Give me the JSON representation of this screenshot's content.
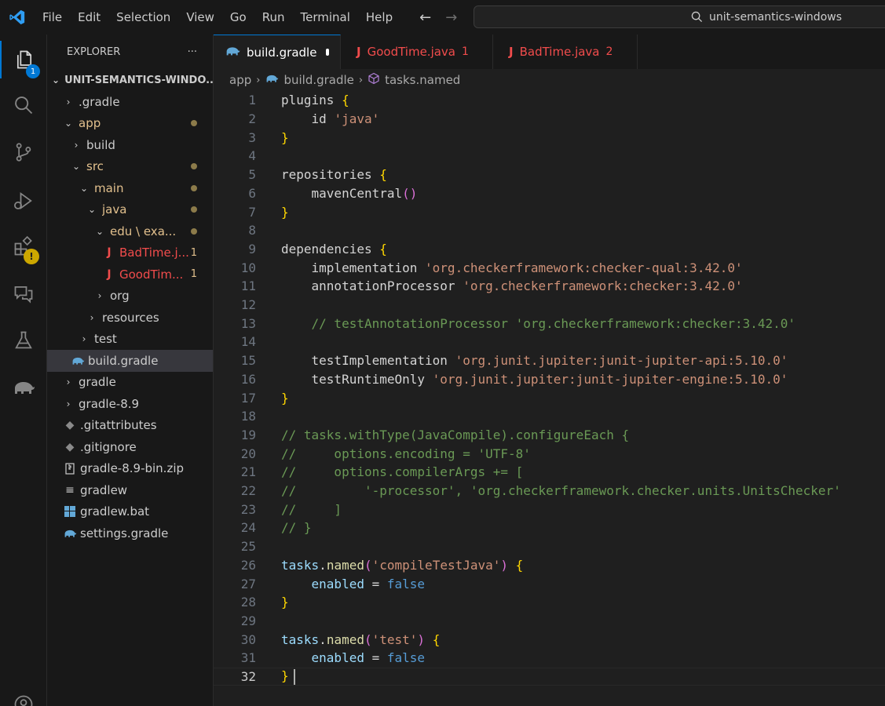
{
  "menu": [
    "File",
    "Edit",
    "Selection",
    "View",
    "Go",
    "Run",
    "Terminal",
    "Help"
  ],
  "search": {
    "text": "unit-semantics-windows"
  },
  "activity": {
    "explorer_badge": "1",
    "extensions_warning": "!"
  },
  "explorer": {
    "title": "EXPLORER",
    "more": "···",
    "root": "UNIT-SEMANTICS-WINDO...",
    "items": [
      {
        "label": ".gradle",
        "depth": 0,
        "kind": "folder",
        "open": false,
        "status": ""
      },
      {
        "label": "app",
        "depth": 0,
        "kind": "folder",
        "open": true,
        "status": "modified",
        "marker": "dot"
      },
      {
        "label": "build",
        "depth": 1,
        "kind": "folder",
        "open": false,
        "status": ""
      },
      {
        "label": "src",
        "depth": 1,
        "kind": "folder",
        "open": true,
        "status": "modified",
        "marker": "dot"
      },
      {
        "label": "main",
        "depth": 2,
        "kind": "folder",
        "open": true,
        "status": "modified",
        "marker": "dot"
      },
      {
        "label": "java",
        "depth": 3,
        "kind": "folder",
        "open": true,
        "status": "modified",
        "marker": "dot"
      },
      {
        "label": "edu \\ exa...",
        "depth": 4,
        "kind": "folder",
        "open": true,
        "status": "modified",
        "marker": "dot"
      },
      {
        "label": "BadTime.j...",
        "depth": 5,
        "kind": "java",
        "status": "modified",
        "marker": "count",
        "count": "1"
      },
      {
        "label": "GoodTim...",
        "depth": 5,
        "kind": "java",
        "status": "modified",
        "marker": "count",
        "count": "1"
      },
      {
        "label": "org",
        "depth": 4,
        "kind": "folder",
        "open": false,
        "status": ""
      },
      {
        "label": "resources",
        "depth": 3,
        "kind": "folder",
        "open": false,
        "status": ""
      },
      {
        "label": "test",
        "depth": 2,
        "kind": "folder",
        "open": false,
        "status": ""
      },
      {
        "label": "build.gradle",
        "depth": 1,
        "kind": "gradle",
        "status": "",
        "selected": true
      },
      {
        "label": "gradle",
        "depth": 0,
        "kind": "folder",
        "open": false,
        "status": ""
      },
      {
        "label": "gradle-8.9",
        "depth": 0,
        "kind": "folder",
        "open": false,
        "status": ""
      },
      {
        "label": ".gitattributes",
        "depth": 0,
        "kind": "git",
        "status": ""
      },
      {
        "label": ".gitignore",
        "depth": 0,
        "kind": "git",
        "status": ""
      },
      {
        "label": "gradle-8.9-bin.zip",
        "depth": 0,
        "kind": "zip",
        "status": ""
      },
      {
        "label": "gradlew",
        "depth": 0,
        "kind": "text",
        "status": ""
      },
      {
        "label": "gradlew.bat",
        "depth": 0,
        "kind": "windows",
        "status": ""
      },
      {
        "label": "settings.gradle",
        "depth": 0,
        "kind": "gradle",
        "status": ""
      }
    ]
  },
  "tabs": [
    {
      "label": "build.gradle",
      "icon": "gradle",
      "active": true,
      "dirty": true,
      "count": ""
    },
    {
      "label": "GoodTime.java",
      "icon": "java",
      "active": false,
      "dirty": false,
      "count": "1"
    },
    {
      "label": "BadTime.java",
      "icon": "java",
      "active": false,
      "dirty": false,
      "count": "2"
    }
  ],
  "breadcrumbs": {
    "folder": "app",
    "file": "build.gradle",
    "symbol": "tasks.named"
  },
  "code_lines": [
    {
      "n": "1",
      "t": [
        [
          "ident",
          "plugins "
        ],
        [
          "brace",
          "{"
        ]
      ]
    },
    {
      "n": "2",
      "t": [
        [
          "ident",
          "    id "
        ],
        [
          "str",
          "'java'"
        ]
      ]
    },
    {
      "n": "3",
      "t": [
        [
          "brace",
          "}"
        ]
      ]
    },
    {
      "n": "4",
      "t": []
    },
    {
      "n": "5",
      "t": [
        [
          "ident",
          "repositories "
        ],
        [
          "brace",
          "{"
        ]
      ]
    },
    {
      "n": "6",
      "t": [
        [
          "ident",
          "    mavenCentral"
        ],
        [
          "paren",
          "()"
        ]
      ]
    },
    {
      "n": "7",
      "t": [
        [
          "brace",
          "}"
        ]
      ]
    },
    {
      "n": "8",
      "t": []
    },
    {
      "n": "9",
      "t": [
        [
          "ident",
          "dependencies "
        ],
        [
          "brace",
          "{"
        ]
      ]
    },
    {
      "n": "10",
      "t": [
        [
          "ident",
          "    implementation "
        ],
        [
          "str",
          "'org.checkerframework:checker-qual:3.42.0'"
        ]
      ]
    },
    {
      "n": "11",
      "t": [
        [
          "ident",
          "    annotationProcessor "
        ],
        [
          "str",
          "'org.checkerframework:checker:3.42.0'"
        ]
      ]
    },
    {
      "n": "12",
      "t": []
    },
    {
      "n": "13",
      "t": [
        [
          "com",
          "    // testAnnotationProcessor 'org.checkerframework:checker:3.42.0'"
        ]
      ]
    },
    {
      "n": "14",
      "t": []
    },
    {
      "n": "15",
      "t": [
        [
          "ident",
          "    testImplementation "
        ],
        [
          "str",
          "'org.junit.jupiter:junit-jupiter-api:5.10.0'"
        ]
      ]
    },
    {
      "n": "16",
      "t": [
        [
          "ident",
          "    testRuntimeOnly "
        ],
        [
          "str",
          "'org.junit.jupiter:junit-jupiter-engine:5.10.0'"
        ]
      ]
    },
    {
      "n": "17",
      "t": [
        [
          "brace",
          "}"
        ]
      ]
    },
    {
      "n": "18",
      "t": []
    },
    {
      "n": "19",
      "t": [
        [
          "com",
          "// tasks.withType(JavaCompile).configureEach {"
        ]
      ]
    },
    {
      "n": "20",
      "t": [
        [
          "com",
          "//     options.encoding = 'UTF-8'"
        ]
      ]
    },
    {
      "n": "21",
      "t": [
        [
          "com",
          "//     options.compilerArgs += ["
        ]
      ]
    },
    {
      "n": "22",
      "t": [
        [
          "com",
          "//         '-processor', 'org.checkerframework.checker.units.UnitsChecker'"
        ]
      ]
    },
    {
      "n": "23",
      "t": [
        [
          "com",
          "//     ]"
        ]
      ]
    },
    {
      "n": "24",
      "t": [
        [
          "com",
          "// }"
        ]
      ]
    },
    {
      "n": "25",
      "t": []
    },
    {
      "n": "26",
      "t": [
        [
          "var",
          "tasks"
        ],
        [
          "ident",
          "."
        ],
        [
          "fn",
          "named"
        ],
        [
          "paren",
          "("
        ],
        [
          "str",
          "'compileTestJava'"
        ],
        [
          "paren",
          ")"
        ],
        [
          "ident",
          " "
        ],
        [
          "brace",
          "{"
        ]
      ]
    },
    {
      "n": "27",
      "t": [
        [
          "var",
          "    enabled"
        ],
        [
          "ident",
          " = "
        ],
        [
          "kw",
          "false"
        ]
      ]
    },
    {
      "n": "28",
      "t": [
        [
          "brace",
          "}"
        ]
      ]
    },
    {
      "n": "29",
      "t": []
    },
    {
      "n": "30",
      "t": [
        [
          "var",
          "tasks"
        ],
        [
          "ident",
          "."
        ],
        [
          "fn",
          "named"
        ],
        [
          "paren",
          "("
        ],
        [
          "str",
          "'test'"
        ],
        [
          "paren",
          ")"
        ],
        [
          "ident",
          " "
        ],
        [
          "brace",
          "{"
        ]
      ]
    },
    {
      "n": "31",
      "t": [
        [
          "var",
          "    enabled"
        ],
        [
          "ident",
          " = "
        ],
        [
          "kw",
          "false"
        ]
      ]
    },
    {
      "n": "32",
      "t": [
        [
          "brace",
          "}"
        ]
      ],
      "current": true
    }
  ]
}
